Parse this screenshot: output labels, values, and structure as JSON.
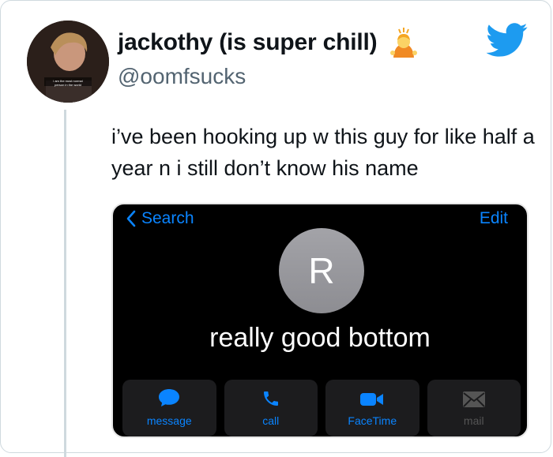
{
  "tweet": {
    "display_name": "jackothy (is super chill)",
    "handle": "@oomfsucks",
    "text": "i’ve been hooking up w this guy for like half a year n i still don’t know his name",
    "avatar_caption": "i am the most normal person in the world",
    "icons": {
      "emoji": "person-gesturing-ok-emoji",
      "brand": "twitter-bird-icon"
    },
    "brand_color": "#1d9bf0"
  },
  "screenshot": {
    "back_label": "Search",
    "edit_label": "Edit",
    "contact_initial": "R",
    "contact_name": "really good bottom",
    "actions": [
      {
        "label": "message",
        "icon": "message-bubble-icon",
        "enabled": true
      },
      {
        "label": "call",
        "icon": "phone-icon",
        "enabled": true
      },
      {
        "label": "FaceTime",
        "icon": "video-camera-icon",
        "enabled": true
      },
      {
        "label": "mail",
        "icon": "envelope-icon",
        "enabled": false
      }
    ],
    "accent": "#0a84ff"
  }
}
